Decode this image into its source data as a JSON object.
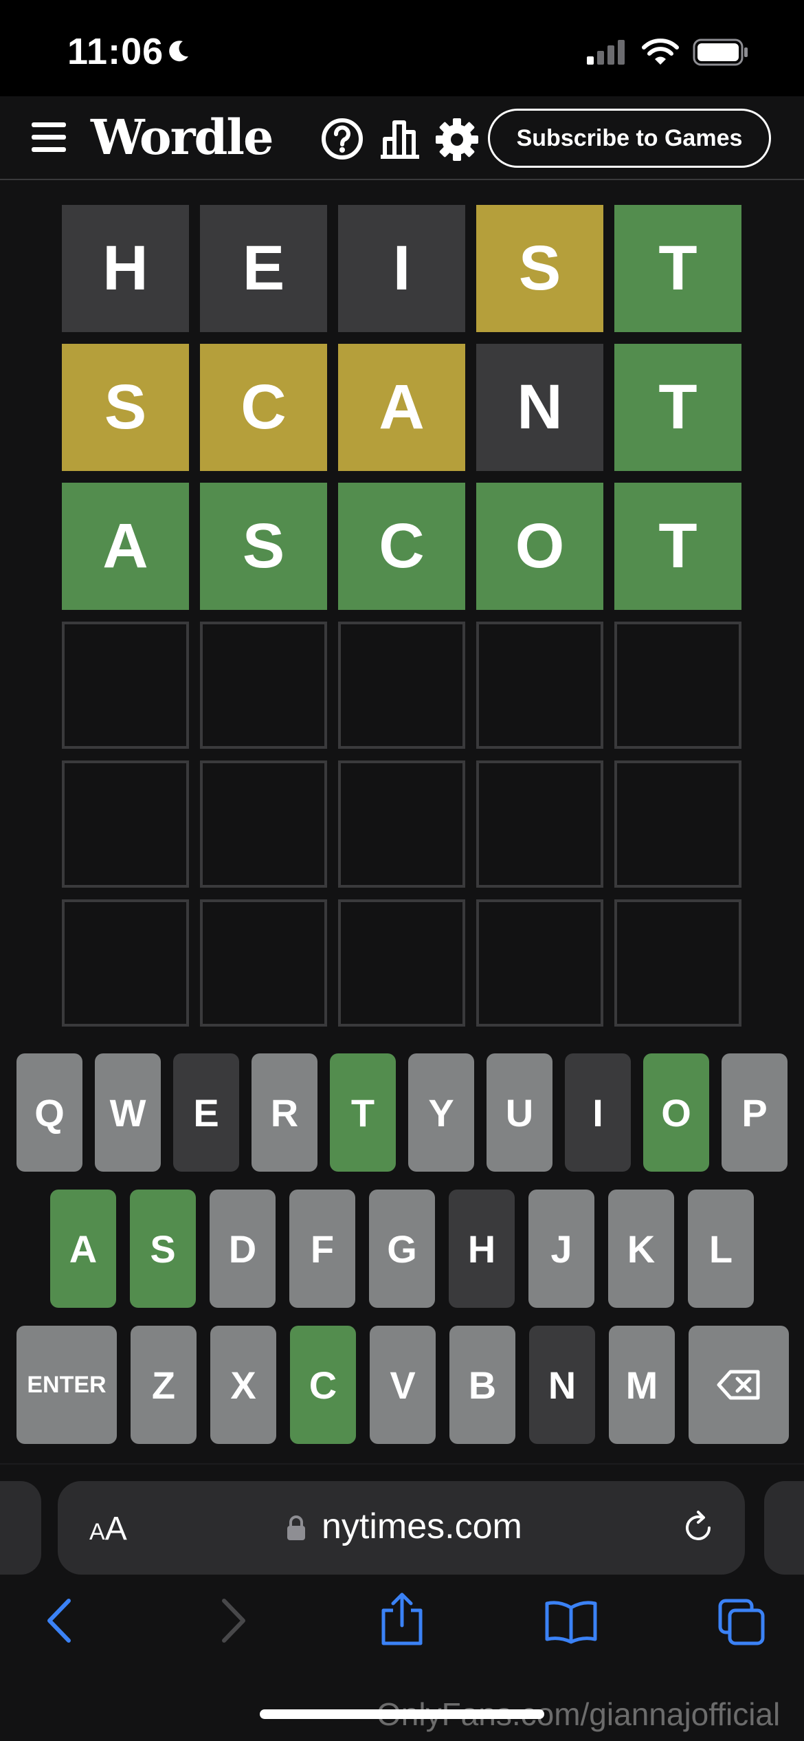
{
  "status_bar": {
    "time": "11:06"
  },
  "header": {
    "logo": "Wordle",
    "subscribe_label": "Subscribe to Games"
  },
  "colors": {
    "correct": "#538d4e",
    "present": "#b59f3b",
    "absent_tile": "#3a3a3c",
    "absent_key": "#3a3a3c",
    "unused_key": "#818384",
    "background": "#121213"
  },
  "board": {
    "rows": [
      {
        "letters": [
          "H",
          "E",
          "I",
          "S",
          "T"
        ],
        "states": [
          "absent",
          "absent",
          "absent",
          "present",
          "correct"
        ]
      },
      {
        "letters": [
          "S",
          "C",
          "A",
          "N",
          "T"
        ],
        "states": [
          "present",
          "present",
          "present",
          "absent",
          "correct"
        ]
      },
      {
        "letters": [
          "A",
          "S",
          "C",
          "O",
          "T"
        ],
        "states": [
          "correct",
          "correct",
          "correct",
          "correct",
          "correct"
        ]
      },
      {
        "letters": [
          "",
          "",
          "",
          "",
          ""
        ],
        "states": [
          "empty",
          "empty",
          "empty",
          "empty",
          "empty"
        ]
      },
      {
        "letters": [
          "",
          "",
          "",
          "",
          ""
        ],
        "states": [
          "empty",
          "empty",
          "empty",
          "empty",
          "empty"
        ]
      },
      {
        "letters": [
          "",
          "",
          "",
          "",
          ""
        ],
        "states": [
          "empty",
          "empty",
          "empty",
          "empty",
          "empty"
        ]
      }
    ]
  },
  "keyboard": {
    "rows": [
      [
        {
          "label": "Q",
          "state": "unused"
        },
        {
          "label": "W",
          "state": "unused"
        },
        {
          "label": "E",
          "state": "absent"
        },
        {
          "label": "R",
          "state": "unused"
        },
        {
          "label": "T",
          "state": "correct"
        },
        {
          "label": "Y",
          "state": "unused"
        },
        {
          "label": "U",
          "state": "unused"
        },
        {
          "label": "I",
          "state": "absent"
        },
        {
          "label": "O",
          "state": "correct"
        },
        {
          "label": "P",
          "state": "unused"
        }
      ],
      [
        {
          "label": "A",
          "state": "correct"
        },
        {
          "label": "S",
          "state": "correct"
        },
        {
          "label": "D",
          "state": "unused"
        },
        {
          "label": "F",
          "state": "unused"
        },
        {
          "label": "G",
          "state": "unused"
        },
        {
          "label": "H",
          "state": "absent"
        },
        {
          "label": "J",
          "state": "unused"
        },
        {
          "label": "K",
          "state": "unused"
        },
        {
          "label": "L",
          "state": "unused"
        }
      ],
      [
        {
          "label": "ENTER",
          "state": "unused",
          "wide": true
        },
        {
          "label": "Z",
          "state": "unused"
        },
        {
          "label": "X",
          "state": "unused"
        },
        {
          "label": "C",
          "state": "correct"
        },
        {
          "label": "V",
          "state": "unused"
        },
        {
          "label": "B",
          "state": "unused"
        },
        {
          "label": "N",
          "state": "absent"
        },
        {
          "label": "M",
          "state": "unused"
        },
        {
          "label": "",
          "state": "unused",
          "wide": true,
          "icon": "backspace-icon"
        }
      ]
    ]
  },
  "browser": {
    "aa_label": "AA",
    "url": "nytimes.com"
  },
  "watermark": "OnlyFans.com/giannajofficial"
}
